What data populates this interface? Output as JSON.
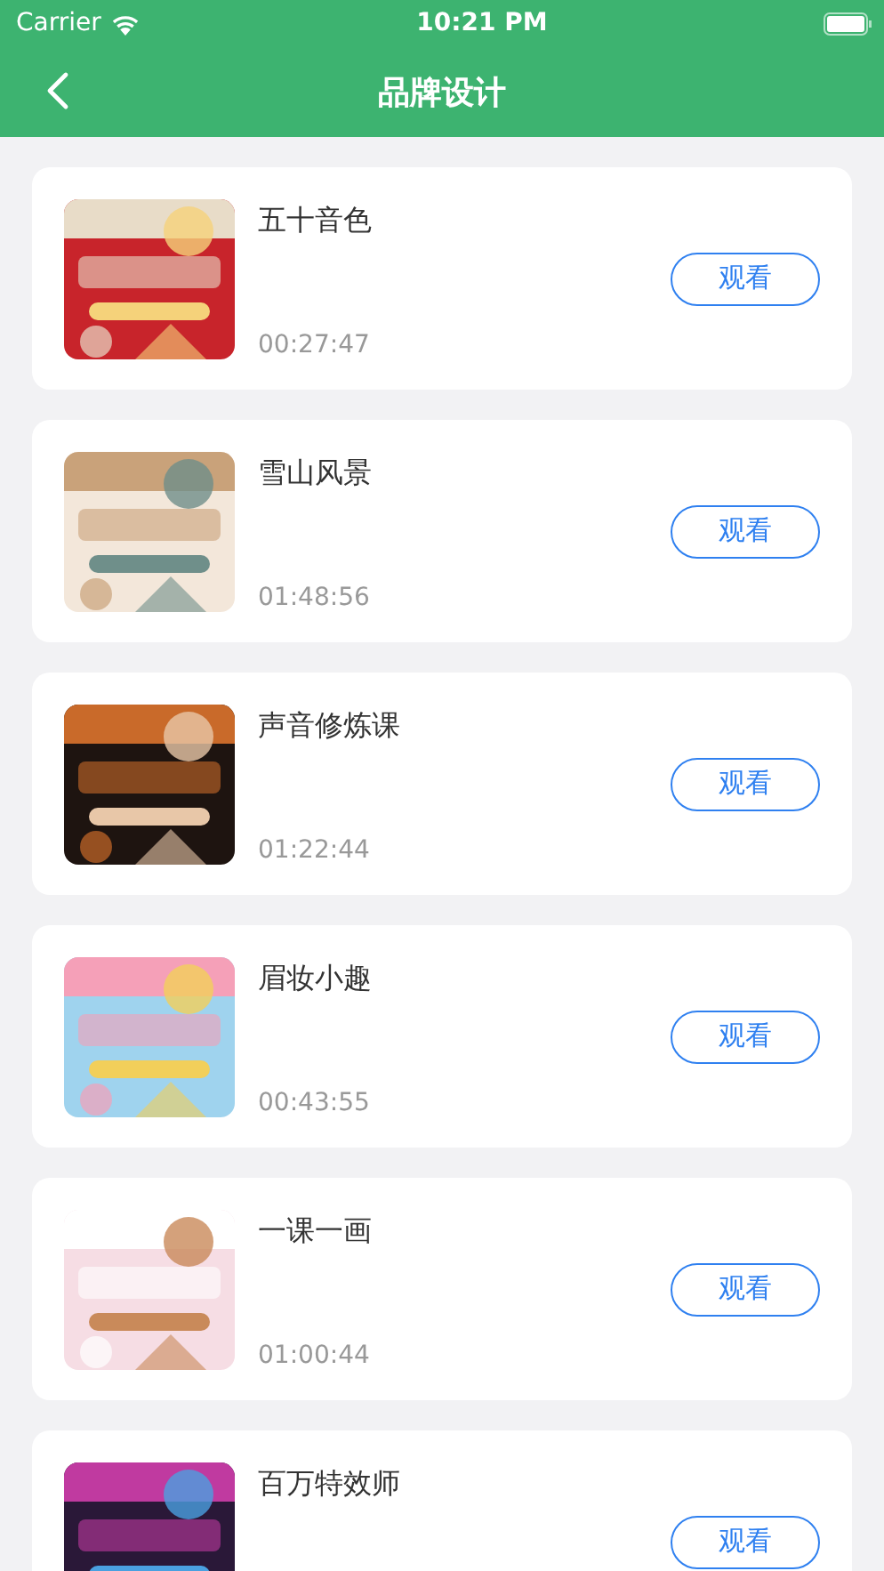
{
  "status_bar": {
    "carrier": "Carrier",
    "time": "10:21 PM"
  },
  "nav": {
    "title": "品牌设计"
  },
  "courses": [
    {
      "title": "五十音色",
      "duration": "00:27:47",
      "button": "观看"
    },
    {
      "title": "雪山风景",
      "duration": "01:48:56",
      "button": "观看"
    },
    {
      "title": "声音修炼课",
      "duration": "01:22:44",
      "button": "观看"
    },
    {
      "title": "眉妆小趣",
      "duration": "00:43:55",
      "button": "观看"
    },
    {
      "title": "一课一画",
      "duration": "01:00:44",
      "button": "观看"
    },
    {
      "title": "百万特效师",
      "button": "观看"
    }
  ]
}
